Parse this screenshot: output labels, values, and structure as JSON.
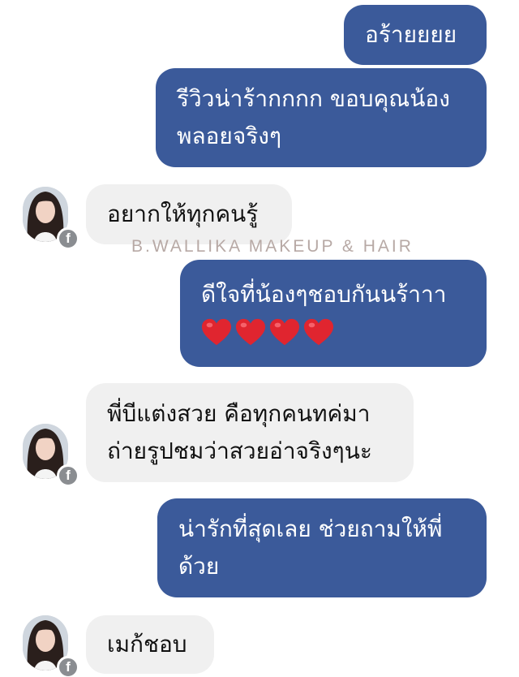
{
  "messages": [
    {
      "side": "out",
      "lines": [
        "อร้ายยยย"
      ]
    },
    {
      "side": "out",
      "lines": [
        "รีวิวน่าร้ากกกก ขอบคุณน้อง",
        "พลอยจริงๆ"
      ]
    },
    {
      "side": "in",
      "lines": [
        "อยากให้ทุกคนรู้"
      ]
    },
    {
      "side": "out",
      "lines": [
        "ดีใจที่น้องๆชอบกันนร้าาา"
      ],
      "emoji": [
        "heart",
        "heart",
        "heart",
        "heart"
      ]
    },
    {
      "side": "in",
      "lines": [
        "พี่บีแต่งสวย คือทุกคนทค่มา",
        "ถ่ายรูปชมว่าสวยอ่าจริงๆนะ"
      ]
    },
    {
      "side": "out",
      "lines": [
        "น่ารักที่สุดเลย ช่วยถามให้พี่",
        "ด้วย"
      ]
    },
    {
      "side": "in",
      "lines": [
        "เมก้ชอบ"
      ]
    }
  ],
  "watermark": "B.WALLIKA MAKEUP & HAIR",
  "badge": "f",
  "colors": {
    "outgoing_bubble": "#3b5a9a",
    "incoming_bubble": "#f0f0f0",
    "heart": "#e0252f"
  },
  "icons": {
    "avatar": "profile-photo-icon",
    "badge": "facebook-icon",
    "heart": "red-heart-emoji-icon"
  }
}
